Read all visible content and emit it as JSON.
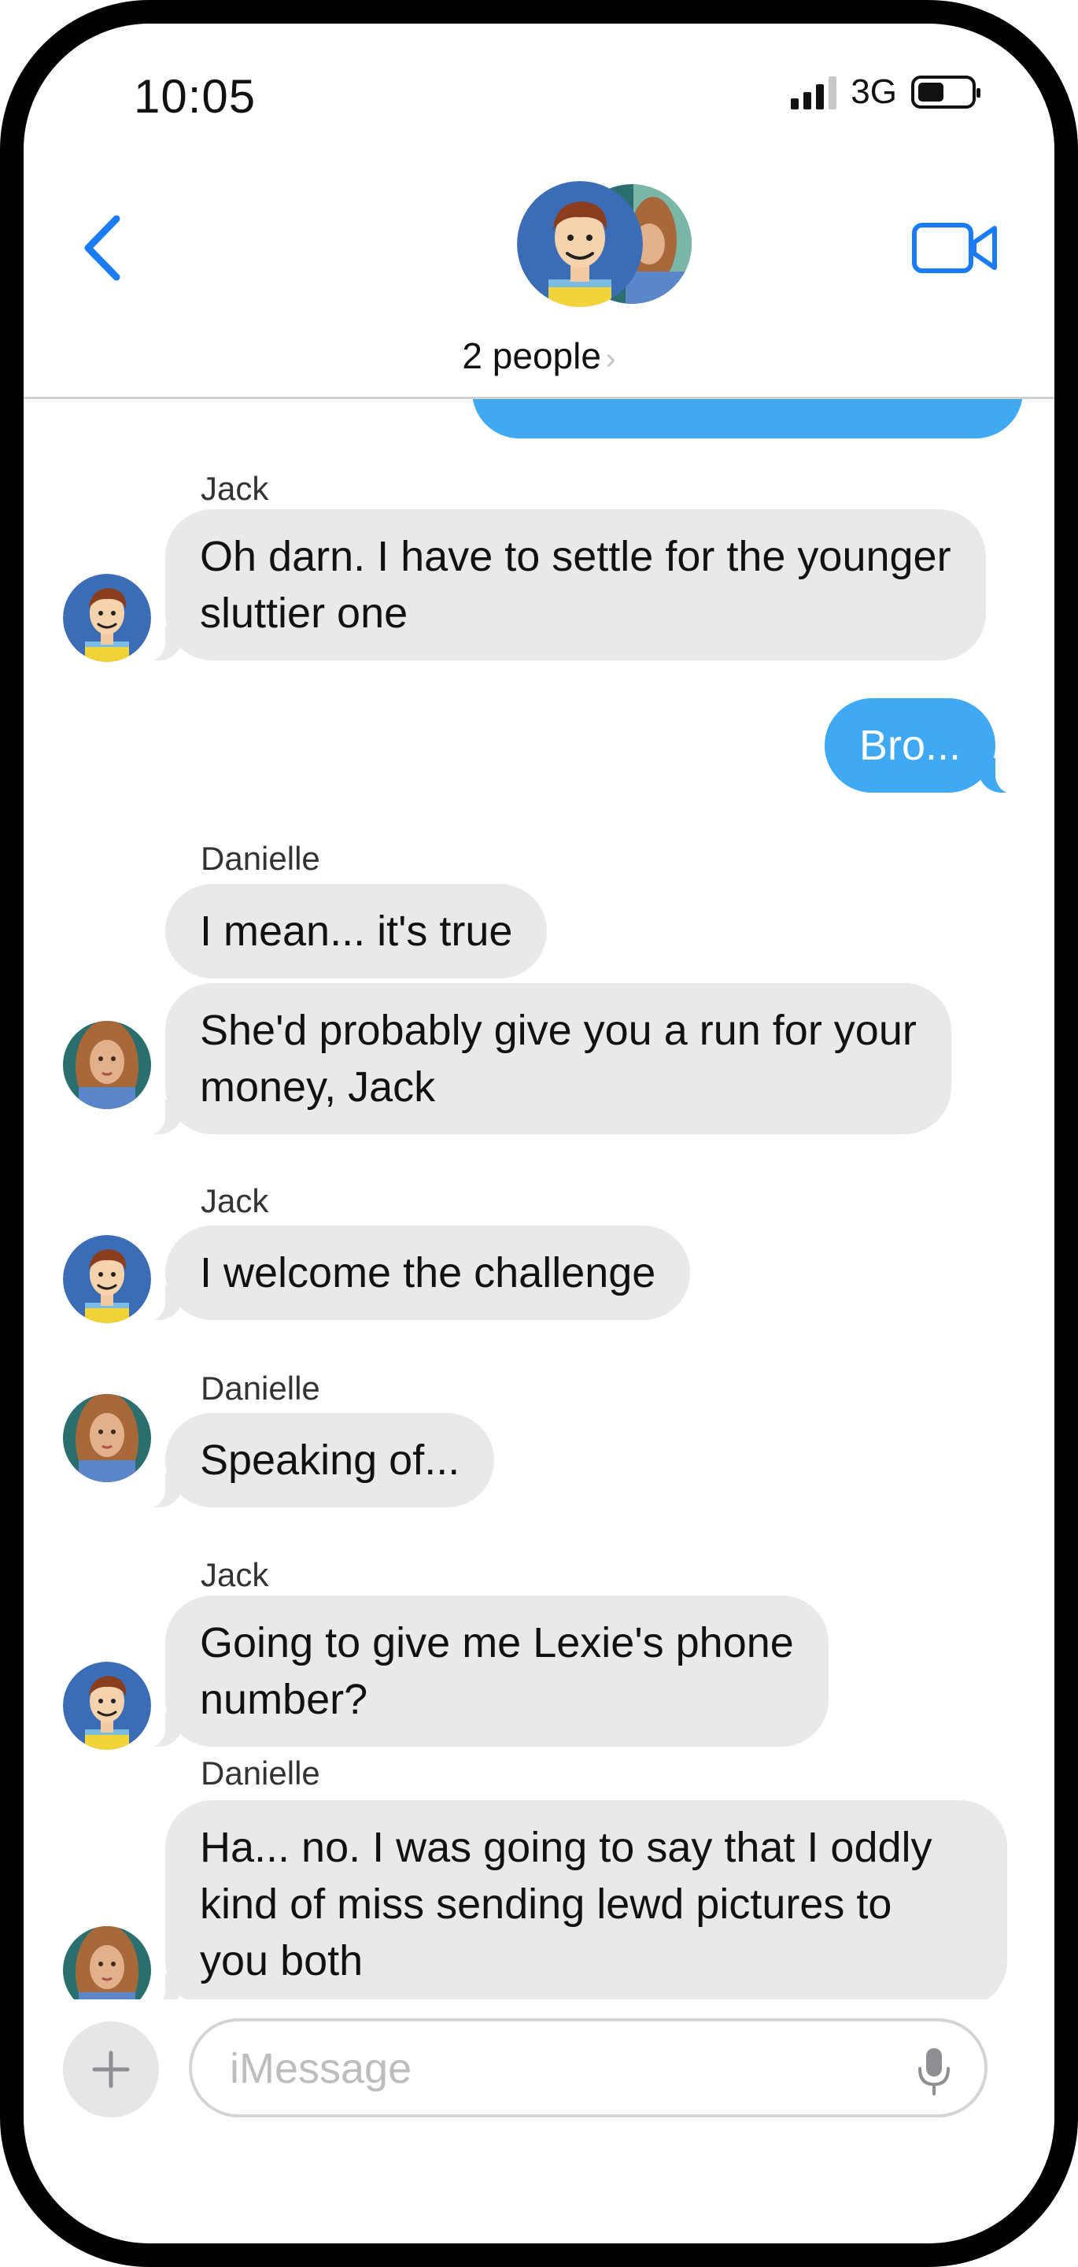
{
  "status_bar": {
    "time": "10:05",
    "network": "3G",
    "signal_bars": 3,
    "battery_level": 0.4
  },
  "header": {
    "title": "2 people",
    "chevron": "›",
    "back_icon": "chevron-left-icon",
    "video_icon": "video-camera-icon"
  },
  "messages": [
    {
      "sender": "Jack",
      "text_lines": [
        "Oh darn.  I have to settle for the younger",
        "sluttier one"
      ]
    },
    {
      "sender": "me",
      "text": "Bro..."
    },
    {
      "sender": "Danielle",
      "text": "I mean... it's true"
    },
    {
      "sender": "Danielle",
      "text_lines": [
        "She'd probably give you a run for your",
        "money, Jack"
      ]
    },
    {
      "sender": "Jack",
      "text": "I welcome the challenge"
    },
    {
      "sender": "Danielle",
      "text": "Speaking of..."
    },
    {
      "sender": "Jack",
      "text_lines": [
        "Going to give me Lexie's phone",
        "number?"
      ]
    },
    {
      "sender": "Danielle",
      "text_lines": [
        "Ha... no.  I was going to say that I oddly",
        "kind of miss sending lewd pictures to",
        "you both"
      ]
    }
  ],
  "input": {
    "placeholder": "iMessage",
    "plus_icon": "plus-icon",
    "mic_icon": "microphone-icon"
  },
  "colors": {
    "accent": "#1a7cf5",
    "outgoing_bubble": "#40a9f4",
    "incoming_bubble": "#e9e9eb"
  }
}
